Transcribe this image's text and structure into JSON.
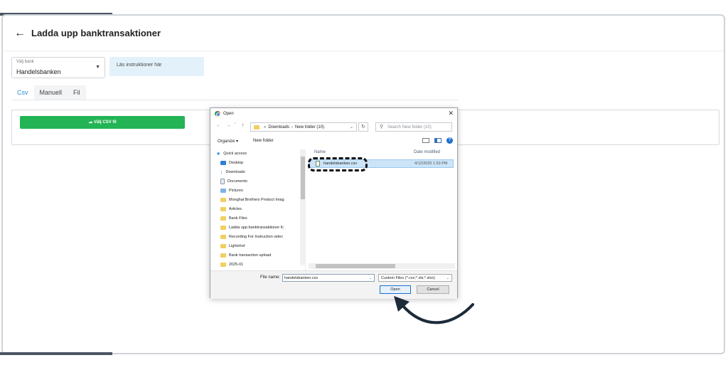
{
  "page": {
    "title": "Ladda upp banktransaktioner",
    "bank_select": {
      "label": "Välj bank",
      "value": "Handelsbanken"
    },
    "instructions": "Läs instruktioner här",
    "tabs": [
      {
        "label": "Csv",
        "active": true
      },
      {
        "label": "Manuell",
        "active": false
      },
      {
        "label": "Fil",
        "active": false
      }
    ],
    "csv_button": "Välj CSV fil",
    "accent_color": "#22b455",
    "link_color": "#2f8ed0"
  },
  "dialog": {
    "title": "Open",
    "address": {
      "root_sep": "«",
      "path": [
        "Downloads",
        "New folder (10)"
      ]
    },
    "search_placeholder": "Search New folder (10)",
    "toolbar": {
      "organize": "Organize ▾",
      "new_folder": "New folder"
    },
    "nav_items": [
      {
        "label": "Quick access",
        "icon": "star-icon"
      },
      {
        "label": "Desktop",
        "icon": "desktop-icon"
      },
      {
        "label": "Downloads",
        "icon": "download-icon"
      },
      {
        "label": "Documents",
        "icon": "document-icon"
      },
      {
        "label": "Pictures",
        "icon": "pictures-icon"
      },
      {
        "label": "Monghal Brothers Product Imag",
        "icon": "folder-icon"
      },
      {
        "label": "Articles",
        "icon": "folder-icon"
      },
      {
        "label": "Bank Files",
        "icon": "folder-icon"
      },
      {
        "label": "Ladda upp banktransaktioner fc",
        "icon": "folder-icon"
      },
      {
        "label": "Recording For Instruction videc",
        "icon": "folder-icon"
      },
      {
        "label": "Lightshot",
        "icon": "folder-icon"
      },
      {
        "label": "Bank transaction upload",
        "icon": "folder-icon"
      },
      {
        "label": "2025-01",
        "icon": "folder-icon"
      }
    ],
    "columns": {
      "name": "Name",
      "date": "Date modified"
    },
    "files": [
      {
        "name": "handelsbanken.csv",
        "date": "4/12/2025 1:53 PM"
      }
    ],
    "file_name_label": "File name:",
    "file_name_value": "handelsbanken.csv",
    "file_type": "Custom Files (*.csv;*.xls;*.xlsx)",
    "open_label": "Open",
    "cancel_label": "Cancel"
  }
}
